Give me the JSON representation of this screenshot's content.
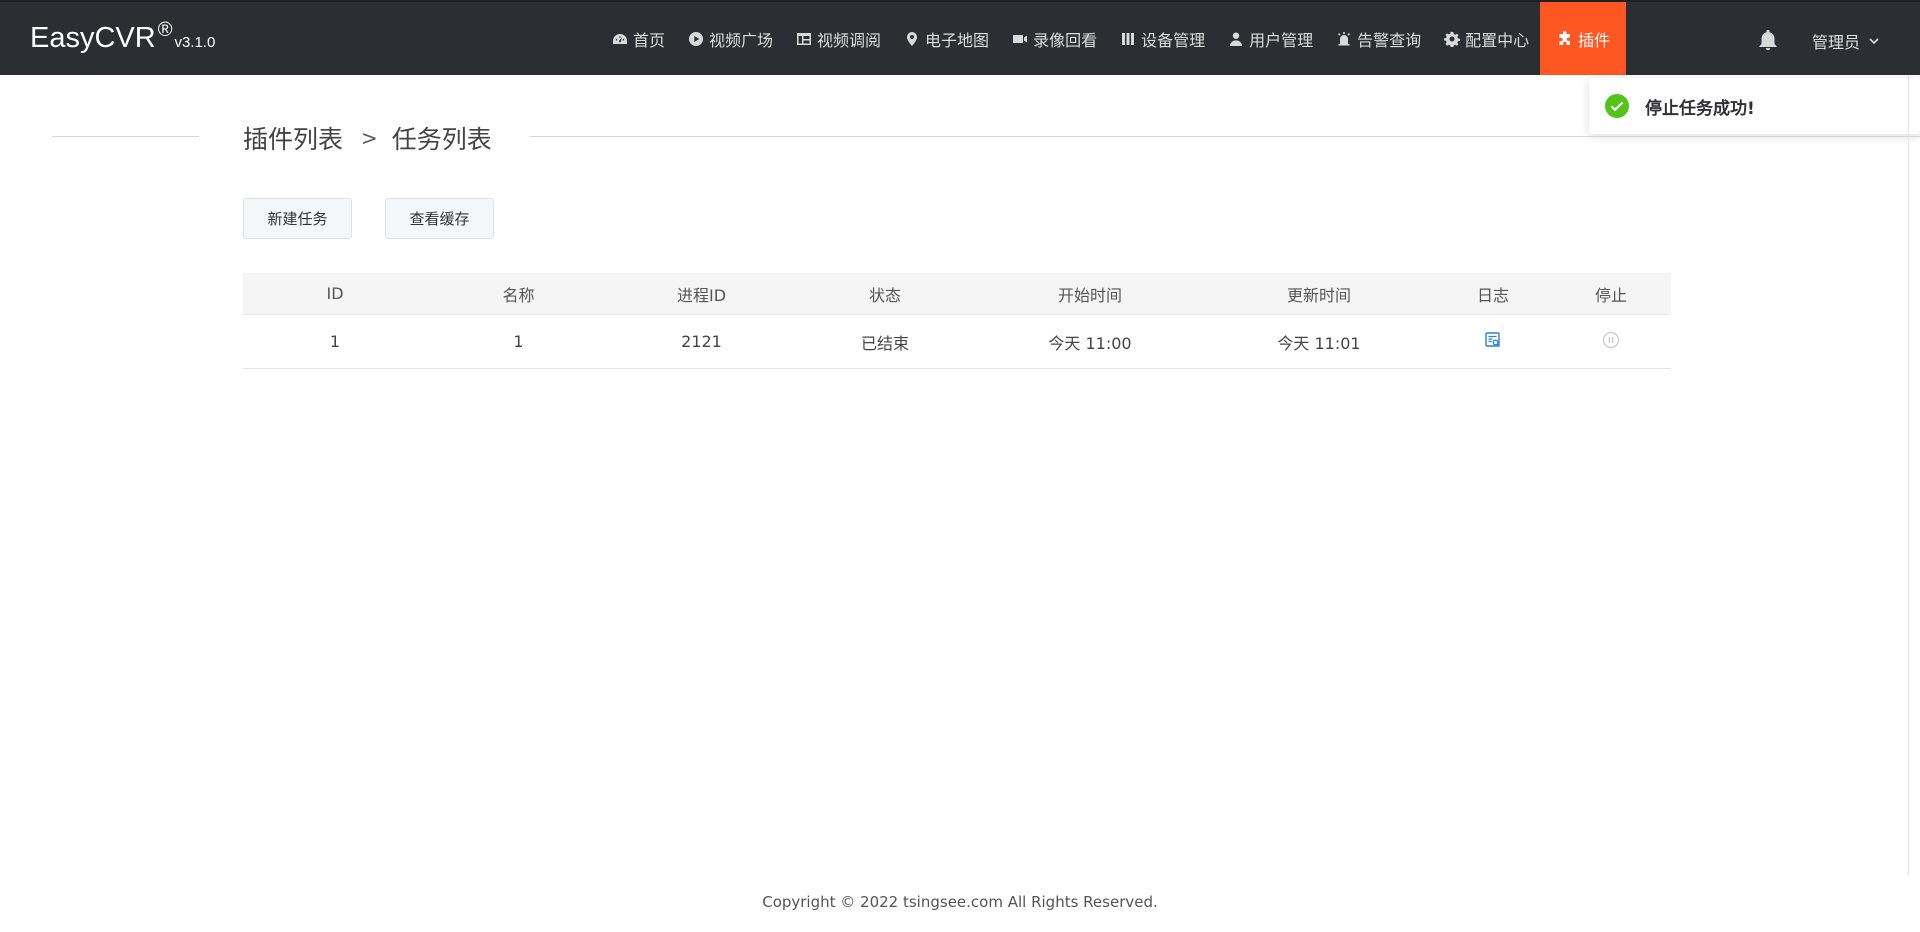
{
  "app": {
    "brand_name": "EasyCVR",
    "brand_reg": "®",
    "version": "v3.1.0"
  },
  "nav": {
    "items": [
      {
        "label": "首页",
        "icon": "dashboard-icon"
      },
      {
        "label": "视频广场",
        "icon": "play-circle-icon"
      },
      {
        "label": "视频调阅",
        "icon": "grid-table-icon"
      },
      {
        "label": "电子地图",
        "icon": "map-pin-icon"
      },
      {
        "label": "录像回看",
        "icon": "video-camera-icon"
      },
      {
        "label": "设备管理",
        "icon": "device-icon"
      },
      {
        "label": "用户管理",
        "icon": "user-icon"
      },
      {
        "label": "告警查询",
        "icon": "alarm-icon"
      },
      {
        "label": "配置中心",
        "icon": "gear-icon"
      },
      {
        "label": "插件",
        "icon": "puzzle-icon",
        "active": true
      }
    ],
    "admin_label": "管理员",
    "accent_color": "#ff5722"
  },
  "breadcrumb": {
    "parent": "插件列表",
    "separator": ">",
    "current": "任务列表"
  },
  "toolbar": {
    "new_task": "新建任务",
    "view_cache": "查看缓存"
  },
  "table": {
    "columns": [
      "ID",
      "名称",
      "进程ID",
      "状态",
      "开始时间",
      "更新时间",
      "日志",
      "停止"
    ],
    "rows": [
      {
        "id": "1",
        "name": "1",
        "pid": "2121",
        "status": "已结束",
        "start": "今天 11:00",
        "update": "今天 11:01",
        "log_icon": "log-view-icon",
        "stop_icon": "pause-circle-icon"
      }
    ]
  },
  "toast": {
    "message": "停止任务成功!",
    "icon": "check-circle-icon",
    "color": "#52c41a"
  },
  "footer": {
    "copyright": "Copyright © 2022 tsingsee.com All Rights Reserved."
  }
}
